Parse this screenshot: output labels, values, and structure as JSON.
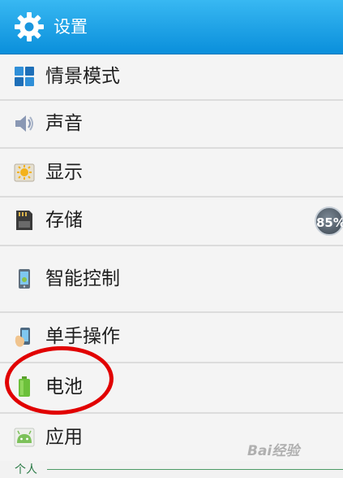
{
  "header": {
    "title": "设置",
    "icon": "gear-icon"
  },
  "items": [
    {
      "label": "情景模式",
      "icon": "grid-tiles-icon"
    },
    {
      "label": "声音",
      "icon": "speaker-icon"
    },
    {
      "label": "显示",
      "icon": "sun-icon"
    },
    {
      "label": "存储",
      "icon": "sd-card-icon",
      "badge": "85%"
    },
    {
      "label": "智能控制",
      "icon": "smart-phone-icon"
    },
    {
      "label": "单手操作",
      "icon": "hand-phone-icon"
    },
    {
      "label": "电池",
      "icon": "battery-icon"
    },
    {
      "label": "应用",
      "icon": "android-icon"
    }
  ],
  "section": {
    "label": "个人"
  },
  "watermark": "Bai经验",
  "colors": {
    "header": "#1ea3e8",
    "accent_green": "#2a7a46",
    "annotation": "#e10000"
  }
}
